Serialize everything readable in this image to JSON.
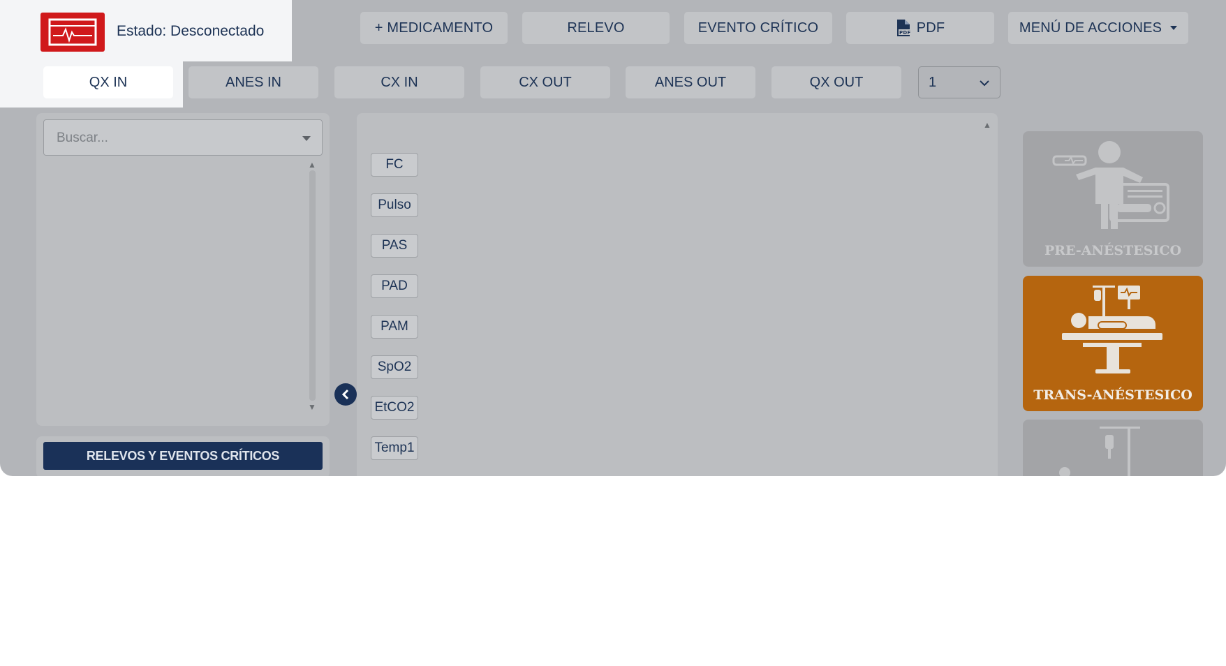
{
  "header": {
    "status_text": "Estado: Desconectado",
    "buttons": {
      "medicamento": "+ MEDICAMENTO",
      "relevo": "RELEVO",
      "evento_critico": "EVENTO CRÍTICO",
      "pdf": "PDF",
      "menu_acciones": "MENÚ DE ACCIONES"
    }
  },
  "tabs": [
    "QX IN",
    "ANES IN",
    "CX IN",
    "CX OUT",
    "ANES OUT",
    "QX OUT"
  ],
  "active_tab": "QX IN",
  "number_select": {
    "value": "1"
  },
  "left_panel": {
    "search_placeholder": "Buscar...",
    "relevos_button": "RELEVOS Y EVENTOS CRÍTICOS"
  },
  "vitals": [
    "FC",
    "Pulso",
    "PAS",
    "PAD",
    "PAM",
    "SpO2",
    "EtCO2",
    "Temp1"
  ],
  "phases": {
    "pre": "PRE-ANÉSTESICO",
    "trans": "TRANS-ANÉSTESICO",
    "active": "TRANS-ANÉSTESICO"
  },
  "colors": {
    "brand_red": "#d0191b",
    "navy": "#1a3158",
    "phase_active": "#b5650f",
    "phase_inactive": "#a3a4a7"
  }
}
